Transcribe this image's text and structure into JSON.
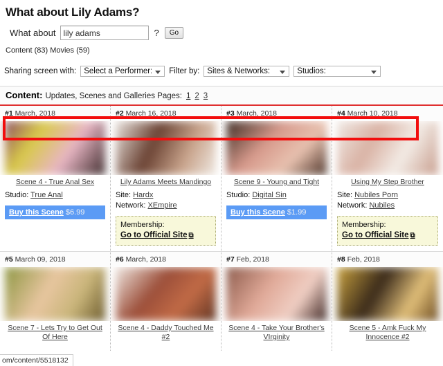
{
  "header": {
    "page_title": "What about Lily Adams?",
    "search_prefix": "What about",
    "search_value": "lily adams",
    "search_placeholder": "",
    "question_mark": "?",
    "go_label": "Go",
    "counts": "Content (83) Movies (59)"
  },
  "filters": {
    "sharing_label": "Sharing screen with:",
    "performer_select": "Select a Performer:",
    "filter_by_label": "Filter by:",
    "sites_select": "Sites & Networks:",
    "studios_select": "Studios:"
  },
  "content_bar": {
    "title": "Content:",
    "subtitle": "Updates, Scenes and Galleries Pages:",
    "pages": [
      "1",
      "2",
      "3"
    ]
  },
  "cards": [
    {
      "index": "#1",
      "date": "March, 2018",
      "title": "Scene 4 - True Anal Sex",
      "meta_label_1": "Studio:",
      "meta_value_1": "True Anal",
      "meta_label_2": "",
      "meta_value_2": "",
      "action_type": "buy",
      "buy_label": "Buy this Scene",
      "price": "$6.99",
      "thumb_colors": [
        "#8d4f62",
        "#d8c94a",
        "#e8b6c4",
        "#3d2b2c"
      ]
    },
    {
      "index": "#2",
      "date": "March 16, 2018",
      "title": "Lily Adams Meets Mandingo",
      "meta_label_1": "Site:",
      "meta_value_1": "Hardx",
      "meta_label_2": "Network:",
      "meta_value_2": "XEmpire",
      "action_type": "membership",
      "membership_label": "Membership:",
      "membership_link": "Go to Official Site",
      "thumb_colors": [
        "#e9e2dd",
        "#6b4334",
        "#c9a48c",
        "#efe9e2"
      ]
    },
    {
      "index": "#3",
      "date": "March, 2018",
      "title": "Scene 9 - Young and Tight",
      "meta_label_1": "Studio:",
      "meta_value_1": "Digital Sin",
      "meta_label_2": "",
      "meta_value_2": "",
      "action_type": "buy",
      "buy_label": "Buy this Scene",
      "price": "$1.99",
      "thumb_colors": [
        "#3b2a22",
        "#d79a8c",
        "#e8c2b0",
        "#4a3126"
      ]
    },
    {
      "index": "#4",
      "date": "March 10, 2018",
      "title": "Using My Step Brother",
      "meta_label_1": "Site:",
      "meta_value_1": "Nubiles Porn",
      "meta_label_2": "Network:",
      "meta_value_2": "Nubiles",
      "action_type": "membership",
      "membership_label": "Membership:",
      "membership_link": "Go to Official Site",
      "thumb_colors": [
        "#efe8e3",
        "#d9b2a4",
        "#f3ece6",
        "#c79c8c"
      ]
    },
    {
      "index": "#5",
      "date": "March 09, 2018",
      "title": "Scene 7 - Lets Try to Get Out Of Here",
      "meta_label_1": "",
      "meta_value_1": "",
      "meta_label_2": "",
      "meta_value_2": "",
      "action_type": "none",
      "thumb_colors": [
        "#8d9642",
        "#e8c6a0",
        "#c9b57a",
        "#6b5a2c"
      ]
    },
    {
      "index": "#6",
      "date": "March, 2018",
      "title": "Scene 4 - Daddy Touched Me #2",
      "meta_label_1": "",
      "meta_value_1": "",
      "meta_label_2": "",
      "meta_value_2": "",
      "action_type": "none",
      "thumb_colors": [
        "#efe7e1",
        "#9c4f3a",
        "#c26b46",
        "#5e3322"
      ]
    },
    {
      "index": "#7",
      "date": "Feb, 2018",
      "title": "Scene 4 - Take Your Brother's VIrginity",
      "meta_label_1": "",
      "meta_value_1": "",
      "meta_label_2": "",
      "meta_value_2": "",
      "action_type": "none",
      "thumb_colors": [
        "#8c5b4c",
        "#e0a998",
        "#f0cfc4",
        "#3a2320"
      ]
    },
    {
      "index": "#8",
      "date": "Feb, 2018",
      "title": "Scene 5 - Amk Fuck My Innocence #2",
      "meta_label_1": "",
      "meta_value_1": "",
      "meta_label_2": "",
      "meta_value_2": "",
      "action_type": "none",
      "thumb_colors": [
        "#c9a23f",
        "#3a2a1a",
        "#e2c07a",
        "#6b4a20"
      ]
    }
  ],
  "status_bar": {
    "url": "om/content/5518132"
  },
  "icons": {
    "external_link": "⧉",
    "dropdown_arrow": "chevron-down-icon"
  },
  "colors": {
    "accent_blue": "#5b9bf5",
    "annotation_red": "#f20d0d",
    "membership_bg": "#f8f8da"
  }
}
